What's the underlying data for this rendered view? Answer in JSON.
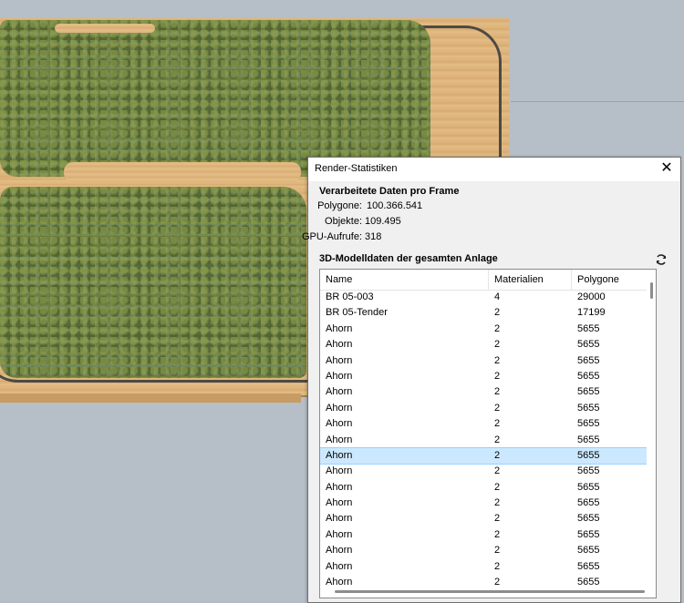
{
  "dialog": {
    "title": "Render-Statistiken",
    "close_label": "✕",
    "frame_section": {
      "heading": "Verarbeitete Daten pro Frame",
      "stats": [
        {
          "label": "Polygone:",
          "value": "100.366.541"
        },
        {
          "label": "Objekte:",
          "value": "109.495"
        },
        {
          "label": "GPU-Aufrufe:",
          "value": "318"
        }
      ]
    },
    "model_section": {
      "heading": "3D-Modelldaten der gesamten Anlage",
      "refresh_icon": "refresh-icon",
      "columns": [
        "Name",
        "Materialien",
        "Polygone"
      ],
      "rows": [
        {
          "name": "BR 05-003",
          "materials": "4",
          "polygons": "29000"
        },
        {
          "name": "BR 05-Tender",
          "materials": "2",
          "polygons": "17199"
        },
        {
          "name": "Ahorn",
          "materials": "2",
          "polygons": "5655"
        },
        {
          "name": "Ahorn",
          "materials": "2",
          "polygons": "5655"
        },
        {
          "name": "Ahorn",
          "materials": "2",
          "polygons": "5655"
        },
        {
          "name": "Ahorn",
          "materials": "2",
          "polygons": "5655"
        },
        {
          "name": "Ahorn",
          "materials": "2",
          "polygons": "5655"
        },
        {
          "name": "Ahorn",
          "materials": "2",
          "polygons": "5655"
        },
        {
          "name": "Ahorn",
          "materials": "2",
          "polygons": "5655"
        },
        {
          "name": "Ahorn",
          "materials": "2",
          "polygons": "5655"
        },
        {
          "name": "Ahorn",
          "materials": "2",
          "polygons": "5655",
          "selected": true
        },
        {
          "name": "Ahorn",
          "materials": "2",
          "polygons": "5655"
        },
        {
          "name": "Ahorn",
          "materials": "2",
          "polygons": "5655"
        },
        {
          "name": "Ahorn",
          "materials": "2",
          "polygons": "5655"
        },
        {
          "name": "Ahorn",
          "materials": "2",
          "polygons": "5655"
        },
        {
          "name": "Ahorn",
          "materials": "2",
          "polygons": "5655"
        },
        {
          "name": "Ahorn",
          "materials": "2",
          "polygons": "5655"
        },
        {
          "name": "Ahorn",
          "materials": "2",
          "polygons": "5655"
        },
        {
          "name": "Ahorn",
          "materials": "2",
          "polygons": "5655"
        }
      ]
    }
  },
  "colors": {
    "selection": "#cce8ff",
    "forest": "#6e7f3c",
    "board": "#e0b880",
    "track": "#4d4a46"
  }
}
